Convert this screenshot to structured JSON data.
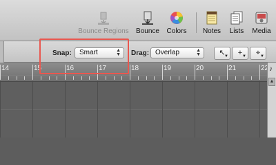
{
  "toolbar": {
    "buttons": [
      {
        "label": "Bounce Regions",
        "icon": "bounce-regions-icon",
        "enabled": false
      },
      {
        "label": "Bounce",
        "icon": "bounce-icon",
        "enabled": true
      },
      {
        "label": "Colors",
        "icon": "colors-icon",
        "enabled": true
      },
      {
        "label": "Notes",
        "icon": "notes-icon",
        "enabled": true
      },
      {
        "label": "Lists",
        "icon": "lists-icon",
        "enabled": true
      },
      {
        "label": "Media",
        "icon": "media-icon",
        "enabled": true
      }
    ]
  },
  "snap": {
    "label": "Snap:",
    "value": "Smart"
  },
  "drag": {
    "label": "Drag:",
    "value": "Overlap"
  },
  "tools": [
    {
      "name": "pointer-tool",
      "glyph": "↖"
    },
    {
      "name": "pencil-tool",
      "glyph": "+"
    },
    {
      "name": "marquee-tool",
      "glyph": "⌖"
    }
  ],
  "ruler": {
    "bars": [
      "14",
      "15",
      "16",
      "17",
      "18",
      "19",
      "20",
      "21",
      "22"
    ]
  },
  "right_strip": {
    "glyph": "♪",
    "up": "▲"
  },
  "colors": {
    "highlight": "#e9574f"
  }
}
